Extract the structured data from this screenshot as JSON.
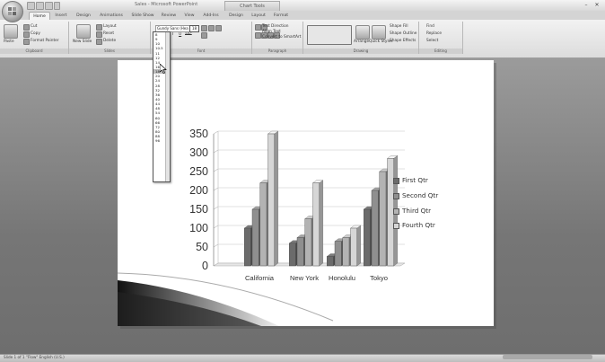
{
  "window": {
    "title": "Sales - Microsoft PowerPoint",
    "context_tab_title": "Chart Tools",
    "min_label": "–",
    "close_label": "✕"
  },
  "tabs": [
    "Home",
    "Insert",
    "Design",
    "Animations",
    "Slide Show",
    "Review",
    "View",
    "Add-Ins",
    "Design",
    "Layout",
    "Format"
  ],
  "ribbon": {
    "clipboard": {
      "paste": "Paste",
      "cut": "Cut",
      "copy": "Copy",
      "format_painter": "Format Painter",
      "label": "Clipboard"
    },
    "slides": {
      "new_slide": "New Slide",
      "layout": "Layout",
      "reset": "Reset",
      "delete": "Delete",
      "label": "Slides"
    },
    "font": {
      "font_name": "Gundy Sans (Hea",
      "font_size": "18",
      "bold": "B",
      "italic": "I",
      "underline": "U",
      "strike": "abc",
      "label": "Font"
    },
    "paragraph": {
      "text_direction": "Text Direction",
      "align_text": "Align Text",
      "convert_smartart": "Convert to SmartArt",
      "label": "Paragraph"
    },
    "drawing": {
      "arrange": "Arrange",
      "quick_styles": "Quick Styles",
      "shape_fill": "Shape Fill",
      "shape_outline": "Shape Outline",
      "shape_effects": "Shape Effects",
      "label": "Drawing"
    },
    "editing": {
      "find": "Find",
      "replace": "Replace",
      "select": "Select",
      "label": "Editing"
    }
  },
  "font_size_dropdown": {
    "selected": "18",
    "options": [
      "8",
      "9",
      "10",
      "10.5",
      "11",
      "12",
      "14",
      "16",
      "18",
      "20",
      "24",
      "28",
      "32",
      "36",
      "40",
      "44",
      "48",
      "54",
      "60",
      "66",
      "72",
      "80",
      "88",
      "96"
    ]
  },
  "status_bar": {
    "text": "Slide 1 of 1   \"Flow\"   English (U.S.)"
  },
  "chart_data": {
    "type": "bar",
    "subtype": "3d-clustered-column",
    "categories": [
      "California",
      "New York",
      "Honolulu",
      "Tokyo"
    ],
    "series": [
      {
        "name": "First Qtr",
        "values": [
          100,
          60,
          25,
          150
        ],
        "color": "#6b6b6b"
      },
      {
        "name": "Second Qtr",
        "values": [
          150,
          75,
          65,
          200
        ],
        "color": "#8f8f8f"
      },
      {
        "name": "Third Qtr",
        "values": [
          220,
          125,
          75,
          250
        ],
        "color": "#b3b3b3"
      },
      {
        "name": "Fourth Qtr",
        "values": [
          350,
          220,
          100,
          285
        ],
        "color": "#d6d6d6"
      }
    ],
    "yticks": [
      "350",
      "300",
      "250",
      "200",
      "150",
      "100",
      "50",
      "0"
    ],
    "ylim": [
      0,
      350
    ],
    "grid": true,
    "legend_position": "right",
    "title": "",
    "xlabel": "",
    "ylabel": ""
  }
}
